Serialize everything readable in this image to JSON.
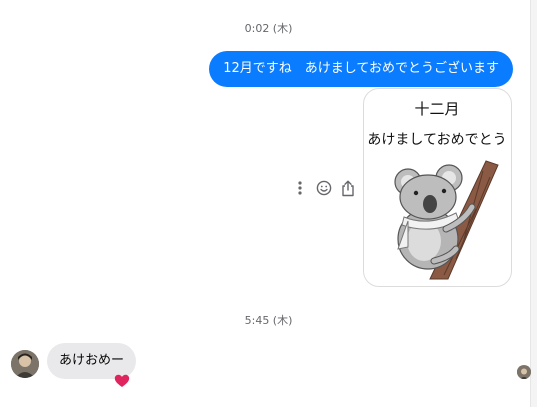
{
  "conversation": {
    "timestamp_1": "0:02 (木)",
    "outgoing_message": "12月ですね　あけましておめでとうございます",
    "sticker": {
      "line_1": "十二月",
      "line_2": "あけましておめでとう"
    },
    "message_actions": [
      "more-icon",
      "emoji-reaction-icon",
      "share-icon"
    ],
    "timestamp_2": "5:45 (木)",
    "incoming_message": "あけおめー",
    "reaction": "❤️"
  },
  "colors": {
    "outgoing_bubble": "#0a7cff",
    "incoming_bubble": "#e9e9eb",
    "timestamp_text": "#65676b"
  }
}
